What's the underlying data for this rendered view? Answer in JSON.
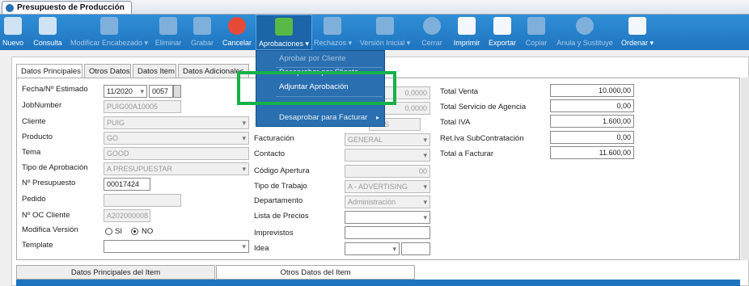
{
  "window": {
    "title": "Presupuesto de Producción"
  },
  "toolbar": {
    "nuevo": "Nuevo",
    "consulta": "Consulta",
    "modificar": "Modificar Encabezado ▾",
    "eliminar": "Eliminar",
    "grabar": "Grabar",
    "cancelar": "Cancelar",
    "aprobaciones": "Aprobaciones ▾",
    "rechazos": "Rechazos ▾",
    "version": "Versión Inicial ▾",
    "cerrar": "Cerrar",
    "imprimir": "Imprimir",
    "exportar": "Exportar",
    "copiar": "Copiar",
    "anula": "Anula y Sustituye",
    "ordenar": "Ordenar ▾"
  },
  "menu": {
    "aprobar_cliente": "Aprobar por Cliente",
    "desaprobar_cliente": "Desaprobar por Cliente",
    "adjuntar": "Adjuntar Aprobación",
    "desaprobar_facturar": "Desaprobar para Facturar"
  },
  "tabs": {
    "principales": "Datos Principales",
    "otros": "Otros Datos",
    "item": "Datos Item",
    "adicionales": "Datos Adicionales"
  },
  "left": {
    "fecha_label": "Fecha/Nº Estimado",
    "fecha_value": "11/2020",
    "estimado_value": "0057",
    "jobnumber_label": "JobNumber",
    "jobnumber_value": "PUIG00A10005",
    "cliente_label": "Cliente",
    "cliente_value": "PUIG",
    "producto_label": "Producto",
    "producto_value": "GO",
    "tema_label": "Tema",
    "tema_value": "GOOD",
    "tipo_aprob_label": "Tipo de Aprobación",
    "tipo_aprob_value": "A PRESUPUESTAR",
    "presupuesto_label": "Nº Presupuesto",
    "presupuesto_value": "00017424",
    "pedido_label": "Pedido",
    "pedido_value": "",
    "oc_label": "Nº OC Cliente",
    "oc_value": "A202000008",
    "modifica_label": "Modifica Versión",
    "si": "SI",
    "no": "NO",
    "template_label": "Template",
    "template_value": ""
  },
  "middle": {
    "v1": "0,0000",
    "v2": "0,0000",
    "dias": "DIAS",
    "facturacion_label": "Facturación",
    "facturacion_value": "GENERAL",
    "contacto_label": "Contacto",
    "contacto_value": "",
    "codigo_label": "Código Apertura",
    "codigo_value": "00",
    "tipo_trabajo_label": "Tipo de Trabajo",
    "tipo_trabajo_value": "A - ADVERTISING",
    "depto_label": "Departamento",
    "depto_value": "Administración",
    "lista_label": "Lista de Precios",
    "lista_value": "",
    "imprevistos_label": "Imprevistos",
    "imprevistos_value": "",
    "idea_label": "Idea",
    "idea_value": ""
  },
  "right": {
    "venta_label": "Total Venta",
    "venta_value": "10.000,00",
    "servicio_label": "Total Servicio de Agencia",
    "servicio_value": "0,00",
    "iva_label": "Total IVA",
    "iva_value": "1.600,00",
    "retiva_label": "Ret.Iva SubContratación",
    "retiva_value": "0,00",
    "facturar_label": "Total a Facturar",
    "facturar_value": "11.600,00"
  },
  "bottom_tabs": {
    "principales": "Datos Principales del Item",
    "otros": "Otros Datos del Item"
  },
  "colors": {
    "ribbon": "#1f74bf",
    "menu": "#2a6fb0",
    "highlight_box": "#15b14a"
  }
}
